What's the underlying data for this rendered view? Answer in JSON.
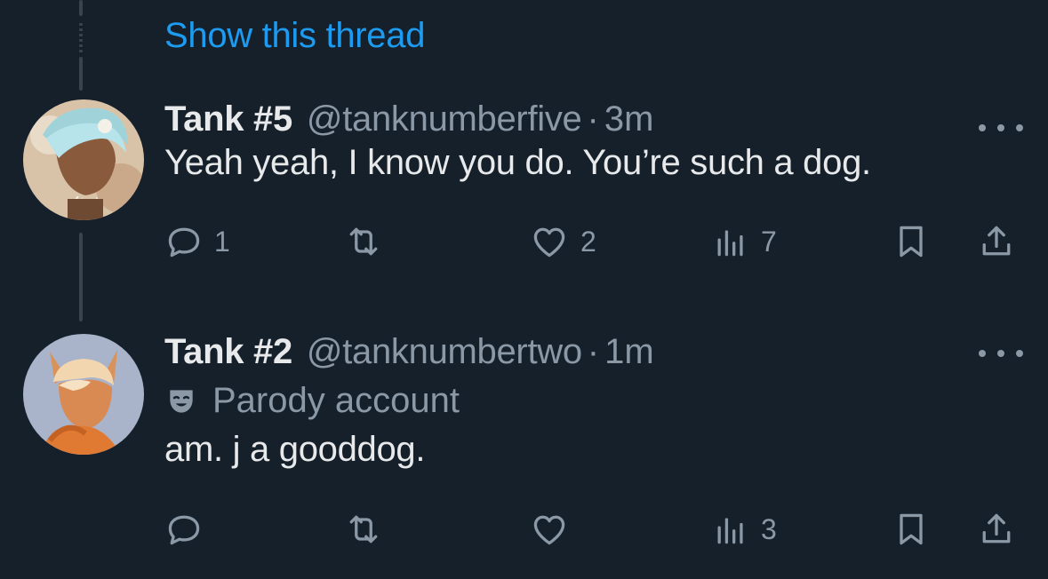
{
  "show_thread": "Show this thread",
  "tweets": [
    {
      "name": "Tank #5",
      "handle": "@tanknumberfive",
      "sep": "·",
      "time": "3m",
      "text": "Yeah yeah, I know you do. You’re such a dog.",
      "actions": {
        "replies": "1",
        "retweets": "",
        "likes": "2",
        "views": "7"
      }
    },
    {
      "name": "Tank #2",
      "handle": "@tanknumbertwo",
      "sep": "·",
      "time": "1m",
      "label": "Parody account",
      "text": "am. j a gooddog.",
      "actions": {
        "replies": "",
        "retweets": "",
        "likes": "",
        "views": "3"
      }
    }
  ],
  "colors": {
    "background": "#15202b",
    "link": "#1d9bf0",
    "muted": "#8b98a5",
    "text": "#e7e9ea",
    "thread_line": "#38444d"
  },
  "icons": [
    "reply-icon",
    "retweet-icon",
    "like-icon",
    "views-icon",
    "bookmark-icon",
    "share-icon",
    "more-icon",
    "parody-mask-icon"
  ]
}
